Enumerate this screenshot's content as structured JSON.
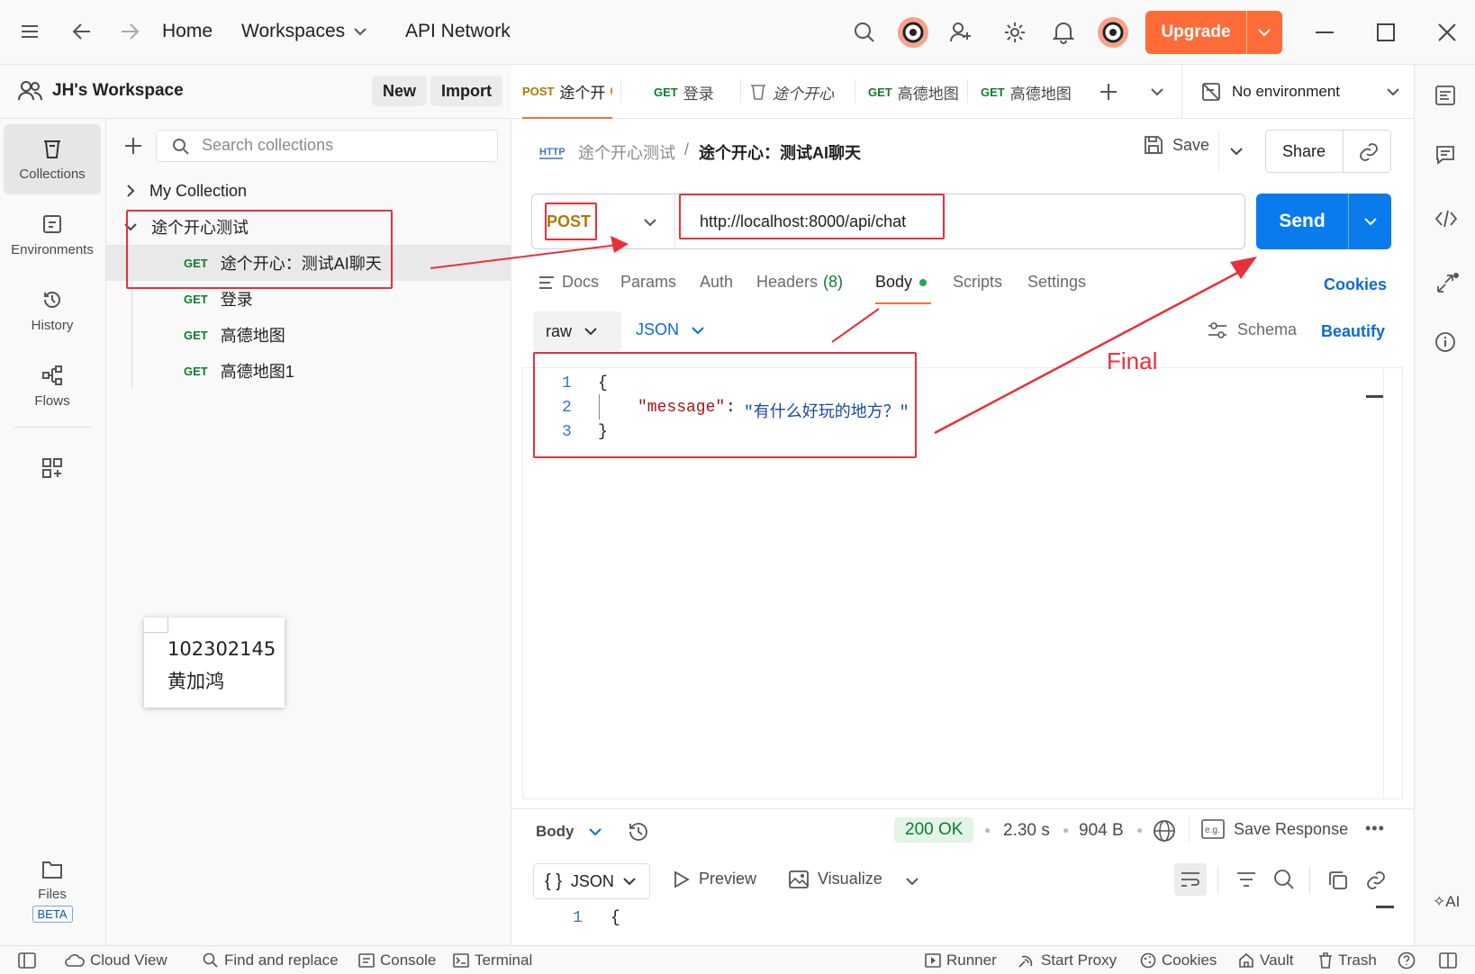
{
  "topbar": {
    "home": "Home",
    "workspaces": "Workspaces",
    "api_network": "API Network",
    "upgrade": "Upgrade"
  },
  "workspace": {
    "name": "JH's Workspace",
    "new_label": "New",
    "import_label": "Import"
  },
  "rail": {
    "collections": "Collections",
    "environments": "Environments",
    "history": "History",
    "flows": "Flows",
    "files": "Files",
    "beta": "BETA"
  },
  "collections_panel": {
    "search_placeholder": "Search collections",
    "items": [
      {
        "label": "My Collection"
      },
      {
        "label": "途个开心测试"
      }
    ],
    "requests": [
      {
        "method": "GET",
        "label": "途个开心：测试AI聊天"
      },
      {
        "method": "GET",
        "label": "登录"
      },
      {
        "method": "GET",
        "label": "高德地图"
      },
      {
        "method": "GET",
        "label": "高德地图1"
      }
    ]
  },
  "tabs": [
    {
      "method": "POST",
      "label": "途个开"
    },
    {
      "method": "GET",
      "label": "登录"
    },
    {
      "method": "",
      "label": "途个开心"
    },
    {
      "method": "GET",
      "label": "高德地图"
    },
    {
      "method": "GET",
      "label": "高德地图"
    }
  ],
  "environment": "No environment",
  "breadcrumb": {
    "parent": "途个开心测试",
    "separator": "/",
    "current": "途个开心：测试AI聊天"
  },
  "actions": {
    "save": "Save",
    "share": "Share",
    "send": "Send"
  },
  "request": {
    "method": "POST",
    "url": "http://localhost:8000/api/chat",
    "tabs": {
      "docs": "Docs",
      "params": "Params",
      "auth": "Auth",
      "headers": "Headers",
      "headers_count": "(8)",
      "body": "Body",
      "scripts": "Scripts",
      "settings": "Settings",
      "cookies": "Cookies"
    },
    "body_mode": "raw",
    "body_format": "JSON",
    "schema": "Schema",
    "beautify": "Beautify",
    "code_lines": [
      {
        "n": "1",
        "text": "{"
      },
      {
        "n": "2",
        "key": "\"message\"",
        "colon": ":",
        "value": "\"有什么好玩的地方？\""
      },
      {
        "n": "3",
        "text": "}"
      }
    ]
  },
  "annotation": {
    "final_label": "Final"
  },
  "sticky_note": {
    "line1": "102302145",
    "line2": "黄加鸿"
  },
  "response": {
    "body": "Body",
    "status": "200 OK",
    "time": "2.30 s",
    "size": "904 B",
    "save_response": "Save Response",
    "format": "JSON",
    "preview": "Preview",
    "visualize": "Visualize",
    "line1_n": "1",
    "line1_text": "{"
  },
  "bottombar": {
    "cloud_view": "Cloud View",
    "find_replace": "Find and replace",
    "console": "Console",
    "terminal": "Terminal",
    "runner": "Runner",
    "start_proxy": "Start Proxy",
    "cookies": "Cookies",
    "vault": "Vault",
    "trash": "Trash"
  },
  "colors": {
    "accent_orange": "#ff6c37",
    "send_blue": "#097bed",
    "get_green": "#0f7b31",
    "post_amber": "#ad7a03",
    "annotation_red": "#e8303a"
  }
}
